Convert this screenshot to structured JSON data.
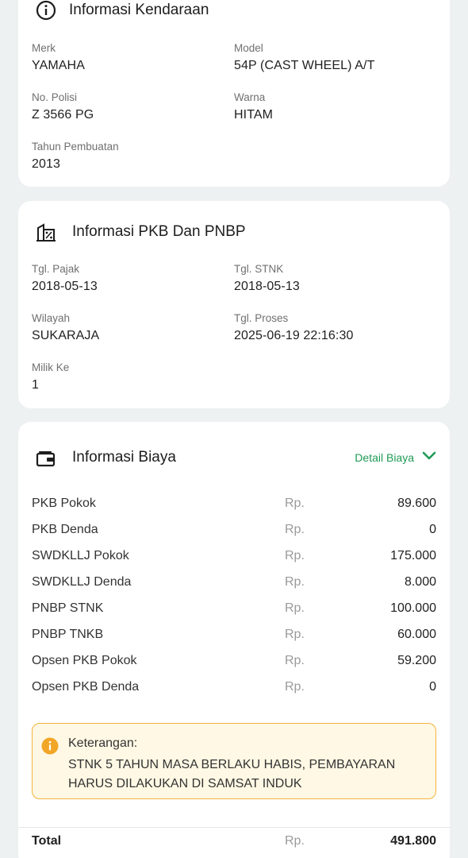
{
  "vehicle": {
    "title": "Informasi Kendaraan",
    "icon": "info-icon",
    "merk_label": "Merk",
    "merk": "YAMAHA",
    "model_label": "Model",
    "model": "54P (CAST WHEEL) A/T",
    "nopol_label": "No. Polisi",
    "nopol": "Z 3566 PG",
    "warna_label": "Warna",
    "warna": "HITAM",
    "tahun_label": "Tahun Pembuatan",
    "tahun": "2013"
  },
  "pkb": {
    "title": "Informasi PKB Dan PNBP",
    "icon": "tax-building-icon",
    "tgl_pajak_label": "Tgl. Pajak",
    "tgl_pajak": "2018-05-13",
    "tgl_stnk_label": "Tgl. STNK",
    "tgl_stnk": "2018-05-13",
    "wilayah_label": "Wilayah",
    "wilayah": "SUKARAJA",
    "tgl_proses_label": "Tgl. Proses",
    "tgl_proses": "2025-06-19 22:16:30",
    "milik_label": "Milik Ke",
    "milik": "1"
  },
  "biaya": {
    "title": "Informasi Biaya",
    "icon": "wallet-icon",
    "detail_label": "Detail Biaya",
    "detail_icon": "chevron-down-icon",
    "accent_color": "#1f9a55",
    "currency": "Rp.",
    "items": [
      {
        "name": "PKB Pokok",
        "amount": "89.600"
      },
      {
        "name": "PKB Denda",
        "amount": "0"
      },
      {
        "name": "SWDKLLJ Pokok",
        "amount": "175.000"
      },
      {
        "name": "SWDKLLJ Denda",
        "amount": "8.000"
      },
      {
        "name": "PNBP STNK",
        "amount": "100.000"
      },
      {
        "name": "PNBP TNKB",
        "amount": "60.000"
      },
      {
        "name": "Opsen PKB Pokok",
        "amount": "59.200"
      },
      {
        "name": "Opsen PKB Denda",
        "amount": "0"
      }
    ],
    "note": {
      "icon": "warning-info-icon",
      "title": "Keterangan:",
      "text": "STNK 5 TAHUN MASA BERLAKU HABIS, PEMBAYARAN HARUS DILAKUKAN DI SAMSAT INDUK",
      "border_color": "#f2b33d",
      "background": "#fff8e4"
    },
    "total_label": "Total",
    "total_amount": "491.800"
  }
}
